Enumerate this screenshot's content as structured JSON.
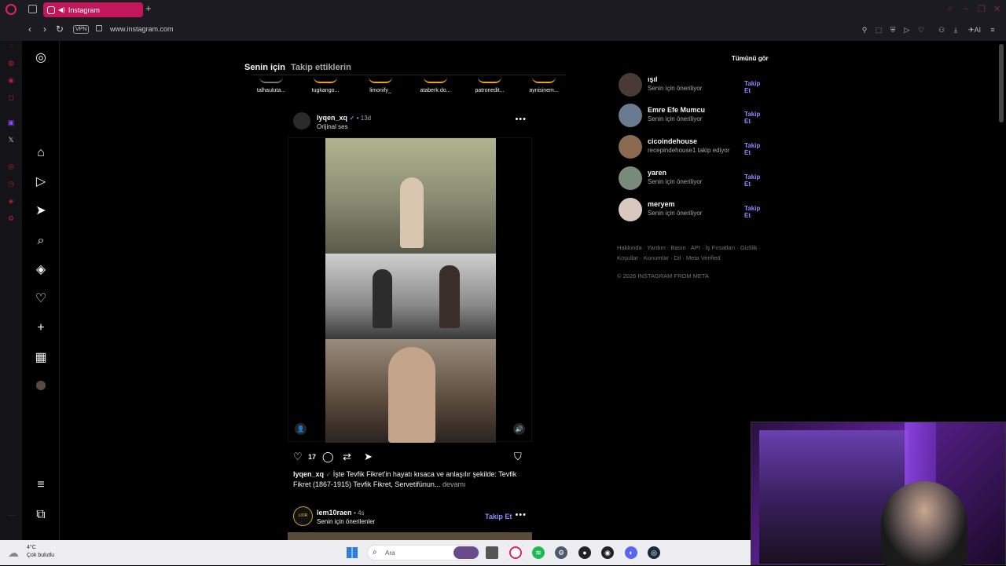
{
  "browser": {
    "tab_title": "Instagram",
    "new_tab": "+",
    "vpn": "VPN",
    "url": "www.instagram.com",
    "ai_label": "AI"
  },
  "feed": {
    "tabs": [
      "Senin için",
      "Takip ettiklerin"
    ]
  },
  "stories": [
    "talhauluta...",
    "tugkango...",
    "limonify_",
    "ataberk.do...",
    "patronedit...",
    "aynisinem..."
  ],
  "post": {
    "username": "lyqen_xq",
    "verified": "✓",
    "time": "• 13d",
    "audio": "Orijinal ses",
    "likes": "17",
    "caption_user": "lyqen_xq",
    "caption_text": "İşte Tevfik Fikret'in hayatı kısaca ve anlaşılır şekilde: Tevfik Fikret (1867-1915) Tevfik Fikret, Servetifünun...",
    "caption_more": "devamı"
  },
  "post2": {
    "username": "lem10raen",
    "time": "• 4s",
    "sub": "Senin için önerilenler",
    "follow": "Takip Et",
    "avatar_text": "LIOR"
  },
  "suggestions": {
    "see_all": "Tümünü gör",
    "items": [
      {
        "name": "ışıl",
        "sub": "Senin için öneriliyor",
        "follow": "Takip Et",
        "color": "#4a3a36"
      },
      {
        "name": "Emre Efe Mumcu",
        "sub": "Senin için öneriliyor",
        "follow": "Takip Et",
        "color": "#6a7a90"
      },
      {
        "name": "cicoindehouse",
        "sub": "recepindehouse1 takip ediyor",
        "follow": "Takip Et",
        "color": "#8a6a50"
      },
      {
        "name": "yaren",
        "sub": "Senin için öneriliyor",
        "follow": "Takip Et",
        "color": "#7a8a7a"
      },
      {
        "name": "meryem",
        "sub": "Senin için öneriliyor",
        "follow": "Takip Et",
        "color": "#d8c8c0"
      }
    ]
  },
  "footer": {
    "links": "Hakkında · Yardım · Basın · API · İş Fırsatları · Gizlilik · Koşullar · Konumlar · Dil · Meta Verified",
    "copyright": "© 2026 INSTAGRAM FROM META"
  },
  "taskbar": {
    "temp": "4°C",
    "condition": "Çok bulutlu",
    "search": "Ara"
  },
  "colors": {
    "tab_accent": "#c2185b",
    "follow_link": "#8c8cff",
    "verified": "#3897f0"
  }
}
